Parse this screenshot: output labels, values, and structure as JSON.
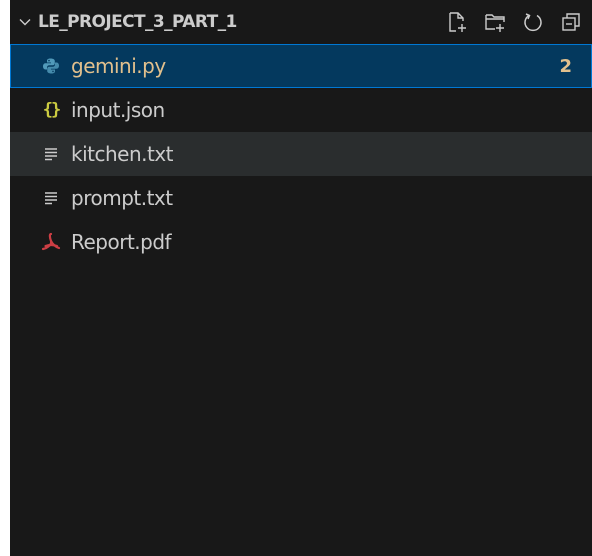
{
  "explorer": {
    "folder_name": "LE_PROJECT_3_PART_1",
    "actions": [
      {
        "name": "new-file",
        "icon": "new-file-icon"
      },
      {
        "name": "new-folder",
        "icon": "new-folder-icon"
      },
      {
        "name": "refresh",
        "icon": "refresh-icon"
      },
      {
        "name": "collapse-all",
        "icon": "collapse-all-icon"
      }
    ],
    "files": [
      {
        "name": "gemini.py",
        "icon": "python-icon",
        "badge": "2",
        "color": "#e2c08d",
        "state": "selected"
      },
      {
        "name": "input.json",
        "icon": "json-icon",
        "glyph": "{}",
        "color": "#cccccc",
        "state": "normal"
      },
      {
        "name": "kitchen.txt",
        "icon": "text-file-icon",
        "color": "#cccccc",
        "state": "hover"
      },
      {
        "name": "prompt.txt",
        "icon": "text-file-icon",
        "color": "#cccccc",
        "state": "normal"
      },
      {
        "name": "Report.pdf",
        "icon": "pdf-icon",
        "color": "#cccccc",
        "state": "normal"
      }
    ]
  },
  "colors": {
    "background": "#181818",
    "selected_background": "#04395e",
    "selected_border": "#0078d4",
    "hover_background": "#2a2d2e",
    "warning_text": "#e2c08d",
    "python_icon": "#519aba",
    "json_icon": "#cbcb41",
    "pdf_icon": "#cc3e44"
  }
}
